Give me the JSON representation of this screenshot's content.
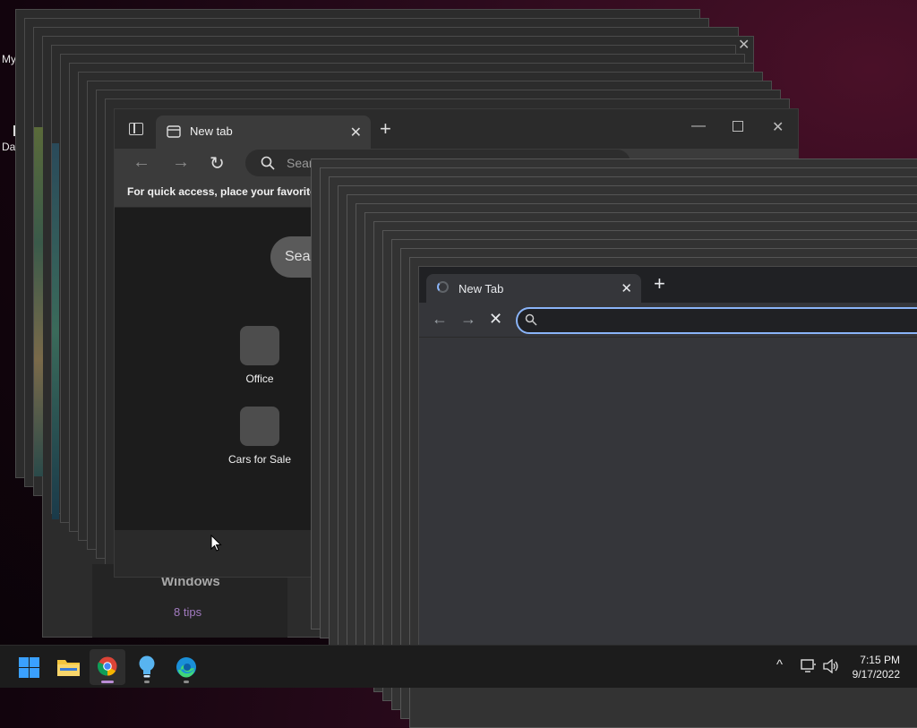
{
  "desktop": {
    "icon_labels": [
      "My",
      "Da"
    ]
  },
  "background_panel": {
    "title": "Windows",
    "subtitle": "8 tips"
  },
  "edge": {
    "tab_label": "New tab",
    "search_placeholder": "Sear",
    "favorites_hint": "For quick access, place your favorites h",
    "search_pill_text": "Sear",
    "tiles": [
      {
        "label": "Office"
      },
      {
        "label": "Cars for Sale"
      }
    ]
  },
  "chrome": {
    "tab_label": "New Tab",
    "omnibox_value": ""
  },
  "taskbar": {
    "apps": [
      "start",
      "file-explorer",
      "chrome",
      "tips",
      "edge"
    ],
    "time": "7:15 PM",
    "date": "9/17/2022"
  },
  "colors": {
    "chrome_focus": "#8ab4f8",
    "active_indicator": "#b98cd4"
  }
}
